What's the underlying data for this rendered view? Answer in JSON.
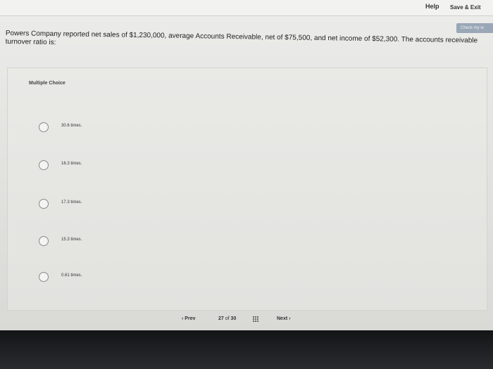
{
  "header": {
    "help_label": "Help",
    "save_exit_label": "Save & Exit",
    "check_work_label": "Check my w"
  },
  "question": {
    "text": "Powers Company reported net sales of $1,230,000, average Accounts Receivable, net of $75,500, and net income of $52,300. The accounts receivable turnover ratio is:"
  },
  "answer_section": {
    "type_label": "Multiple Choice",
    "options": [
      {
        "label": "30.6 times."
      },
      {
        "label": "16.3 times."
      },
      {
        "label": "17.3 times."
      },
      {
        "label": "15.3 times."
      },
      {
        "label": "0.61 times."
      }
    ]
  },
  "footer_nav": {
    "prev_label": "Prev",
    "current": "27",
    "of_label": "of",
    "total": "30",
    "next_label": "Next",
    "grid_icon": "grid-icon"
  }
}
